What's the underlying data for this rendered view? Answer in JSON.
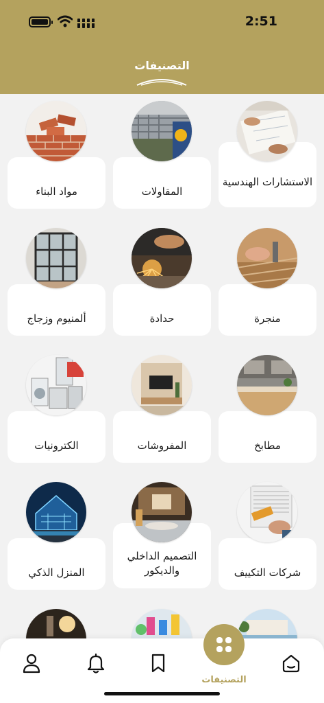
{
  "status_bar": {
    "time": "2:51"
  },
  "header": {
    "title": "التصنيفات"
  },
  "categories": [
    {
      "label": "الاستشارات الهندسية",
      "icon": "engineering-plans-photo"
    },
    {
      "label": "المقاولات",
      "icon": "contractor-photo"
    },
    {
      "label": "مواد البناء",
      "icon": "bricks-photo"
    },
    {
      "label": "منجرة",
      "icon": "carpentry-photo"
    },
    {
      "label": "حدادة",
      "icon": "metalwork-photo"
    },
    {
      "label": "ألمنيوم وزجاج",
      "icon": "aluminum-glass-photo"
    },
    {
      "label": "مطابخ",
      "icon": "kitchen-photo"
    },
    {
      "label": "المفروشات",
      "icon": "furniture-photo"
    },
    {
      "label": "الكترونيات",
      "icon": "appliances-photo"
    },
    {
      "label": "شركات التكييف",
      "icon": "ac-photo"
    },
    {
      "label": "التصميم الداخلي والديكور",
      "icon": "interior-design-photo"
    },
    {
      "label": "المنزل الذكي",
      "icon": "smart-home-photo"
    }
  ],
  "tabbar": {
    "active_label": "التصنيفات",
    "items": [
      {
        "icon": "home-icon"
      },
      {
        "icon": "categories-icon"
      },
      {
        "icon": "bookmark-icon"
      },
      {
        "icon": "bell-icon"
      },
      {
        "icon": "profile-icon"
      }
    ]
  },
  "colors": {
    "brand": "#b4a25e",
    "background": "#f2f2f2",
    "card": "#ffffff"
  }
}
